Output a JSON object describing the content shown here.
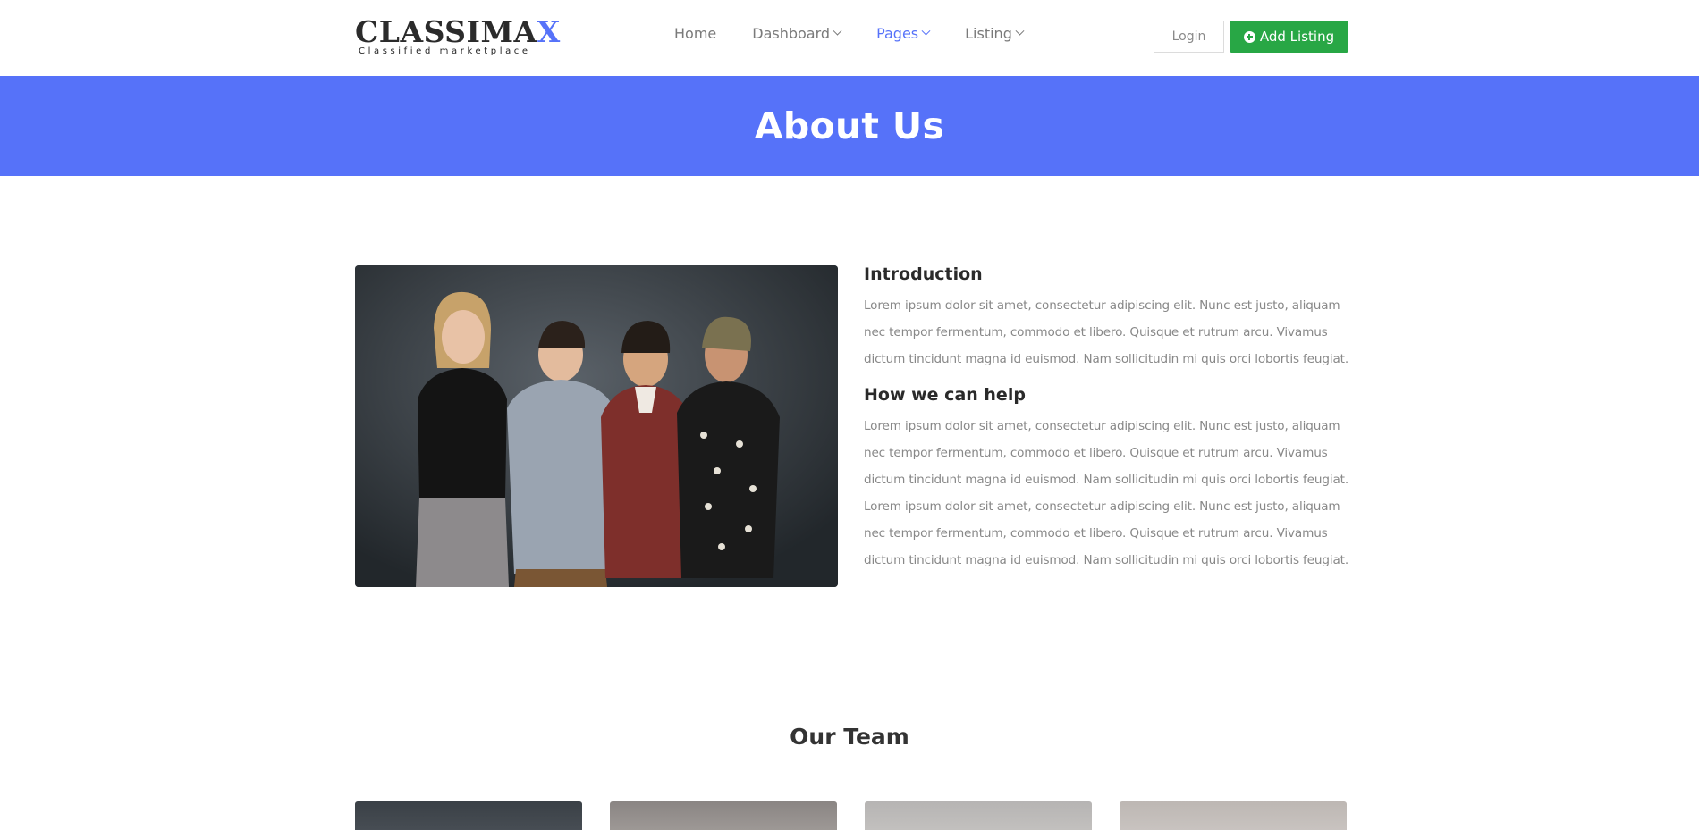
{
  "brand": {
    "name_main": "CLASSIMA",
    "name_accent": "X",
    "tagline": "Classified marketplace"
  },
  "nav": {
    "items": [
      {
        "label": "Home",
        "has_caret": false,
        "active": false
      },
      {
        "label": "Dashboard",
        "has_caret": true,
        "active": false
      },
      {
        "label": "Pages",
        "has_caret": true,
        "active": true
      },
      {
        "label": "Listing",
        "has_caret": true,
        "active": false
      }
    ],
    "login_label": "Login",
    "add_listing_label": "Add Listing",
    "add_listing_icon": "plus-circle-icon"
  },
  "hero": {
    "title": "About Us"
  },
  "about": {
    "image_alt": "Team photo",
    "sections": [
      {
        "heading": "Introduction",
        "body": "Lorem ipsum dolor sit amet, consectetur adipiscing elit. Nunc est justo, aliquam nec tempor fermentum, commodo et libero. Quisque et rutrum arcu. Vivamus dictum tincidunt magna id euismod. Nam sollicitudin mi quis orci lobortis feugiat."
      },
      {
        "heading": "How we can help",
        "body": "Lorem ipsum dolor sit amet, consectetur adipiscing elit. Nunc est justo, aliquam nec tempor fermentum, commodo et libero. Quisque et rutrum arcu. Vivamus dictum tincidunt magna id euismod. Nam sollicitudin mi quis orci lobortis feugiat. Lorem ipsum dolor sit amet, consectetur adipiscing elit. Nunc est justo, aliquam nec tempor fermentum, commodo et libero. Quisque et rutrum arcu. Vivamus dictum tincidunt magna id euismod. Nam sollicitudin mi quis orci lobortis feugiat."
      }
    ]
  },
  "team": {
    "title": "Our Team"
  },
  "colors": {
    "accent": "#5672f9",
    "success": "#28a745",
    "muted_text": "#888888"
  }
}
